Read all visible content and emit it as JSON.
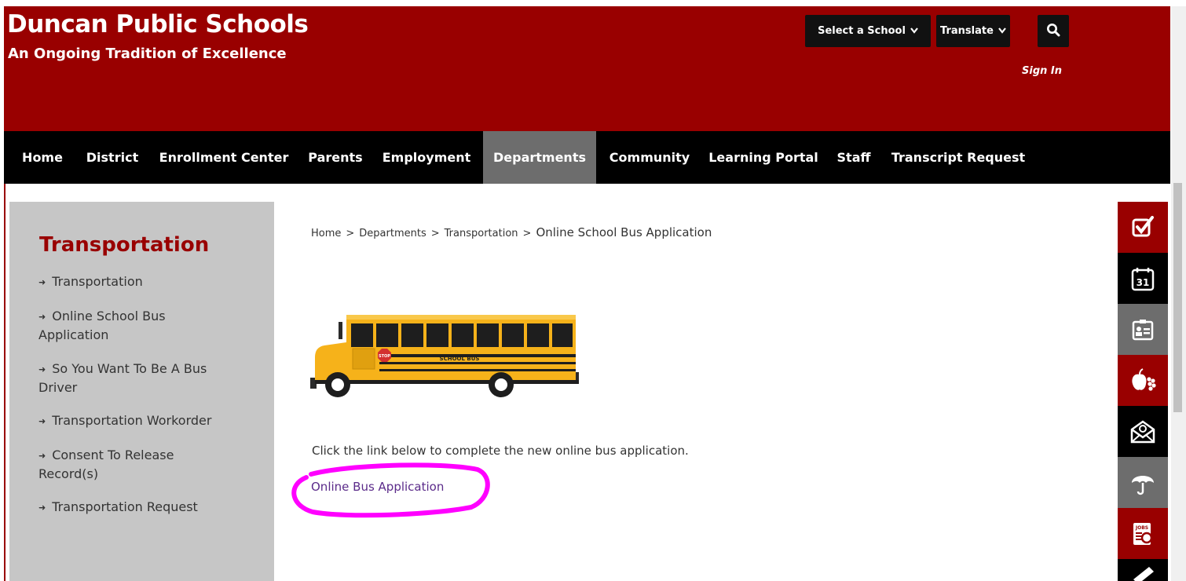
{
  "header": {
    "title": "Duncan Public Schools",
    "tagline": "An Ongoing Tradition of Excellence",
    "select_school": "Select a School",
    "translate": "Translate",
    "sign_in": "Sign In",
    "brand_color": "#990000"
  },
  "nav": {
    "items": [
      {
        "label": "Home"
      },
      {
        "label": "District"
      },
      {
        "label": "Enrollment Center"
      },
      {
        "label": "Parents"
      },
      {
        "label": "Employment"
      },
      {
        "label": "Departments",
        "active": true
      },
      {
        "label": "Community"
      },
      {
        "label": "Learning Portal"
      },
      {
        "label": "Staff"
      },
      {
        "label": "Transcript Request"
      }
    ]
  },
  "sidebar": {
    "title": "Transportation",
    "items": [
      {
        "label": "Transportation"
      },
      {
        "label": "Online School Bus Application"
      },
      {
        "label": "So You Want To Be A Bus Driver"
      },
      {
        "label": "Transportation Workorder"
      },
      {
        "label": "Consent To Release Record(s)"
      },
      {
        "label": "Transportation Request"
      }
    ]
  },
  "breadcrumb": {
    "items": [
      "Home",
      "Departments",
      "Transportation",
      "Online School Bus Application"
    ],
    "separator": ">"
  },
  "content": {
    "bus_sign": "SCHOOL BUS",
    "stop_sign": "STOP",
    "intro": "Click the link below to complete the new online bus application.",
    "link": "Online Bus Application"
  },
  "rail": {
    "icons": [
      "checkbox-icon",
      "calendar-icon",
      "directory-icon",
      "nutrition-icon",
      "email-icon",
      "umbrella-icon",
      "jobs-icon",
      "edit-icon"
    ],
    "calendar_day": "31",
    "jobs_label": "JOBS"
  }
}
